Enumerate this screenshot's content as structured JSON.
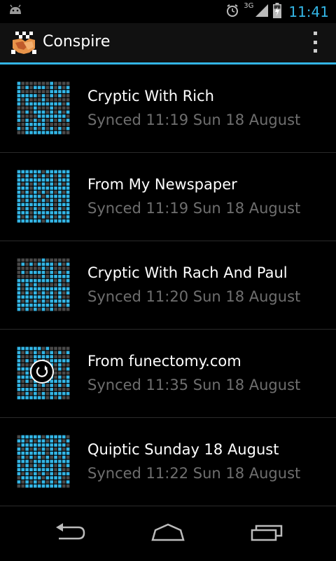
{
  "status_bar": {
    "time": "11:41",
    "network": "3G",
    "icons": [
      "android-icon",
      "alarm-icon",
      "signal-icon",
      "battery-charging-icon"
    ]
  },
  "action_bar": {
    "title": "Conspire",
    "accent_color": "#33b5e5"
  },
  "crosswords": [
    {
      "title": "Cryptic With Rich",
      "synced": "Synced 11:19 Sun 18 August",
      "syncing": false
    },
    {
      "title": "From My Newspaper",
      "synced": "Synced 11:19 Sun 18 August",
      "syncing": false
    },
    {
      "title": "Cryptic With Rach And Paul",
      "synced": "Synced 11:20 Sun 18 August",
      "syncing": false
    },
    {
      "title": "From funectomy.com",
      "synced": "Synced 11:35 Sun 18 August",
      "syncing": true
    },
    {
      "title": "Quiptic Sunday 18 August",
      "synced": "Synced 11:22 Sun 18 August",
      "syncing": false
    }
  ],
  "nav_bar": {
    "icons": [
      "back-icon",
      "home-icon",
      "recent-apps-icon"
    ]
  }
}
